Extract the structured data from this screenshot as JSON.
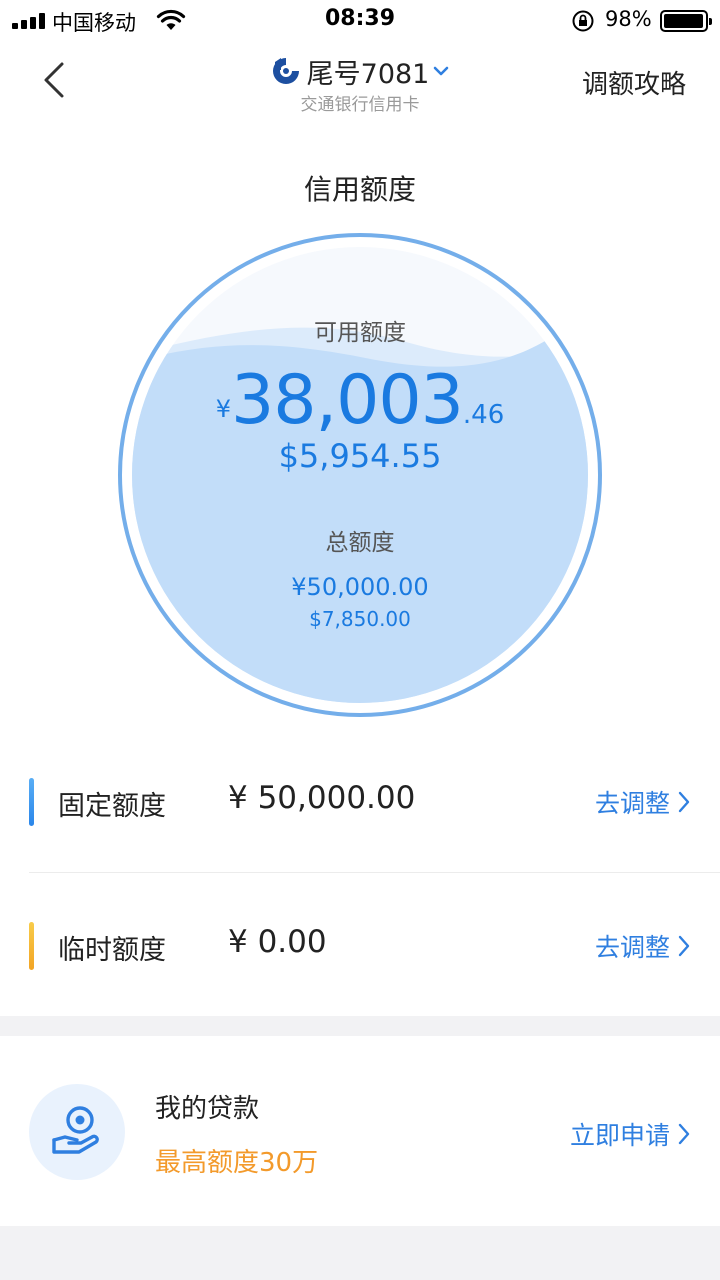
{
  "status_bar": {
    "carrier": "中国移动",
    "time": "08:39",
    "battery": "98%"
  },
  "nav": {
    "card_tail": "尾号7081",
    "bank_name": "交通银行信用卡",
    "guide_label": "调额攻略"
  },
  "section_title": "信用额度",
  "credit": {
    "available_label": "可用额度",
    "available_currency": "¥",
    "available_integer": "38,003",
    "available_decimal": ".46",
    "available_usd": "$5,954.55",
    "total_label": "总额度",
    "total_cny": "¥50,000.00",
    "total_usd": "$7,850.00",
    "available_fraction": 0.76
  },
  "limits": [
    {
      "label": "固定额度",
      "value": "¥ 50,000.00",
      "action": "去调整",
      "color": "#3b93f0"
    },
    {
      "label": "临时额度",
      "value": "¥ 0.00",
      "action": "去调整",
      "color": "#f5b834"
    }
  ],
  "loan": {
    "title": "我的贷款",
    "subtitle": "最高额度30万",
    "action": "立即申请"
  },
  "colors": {
    "accent": "#2f7fe0",
    "amount": "#1a7ae0",
    "loan_highlight": "#f39a2b"
  }
}
